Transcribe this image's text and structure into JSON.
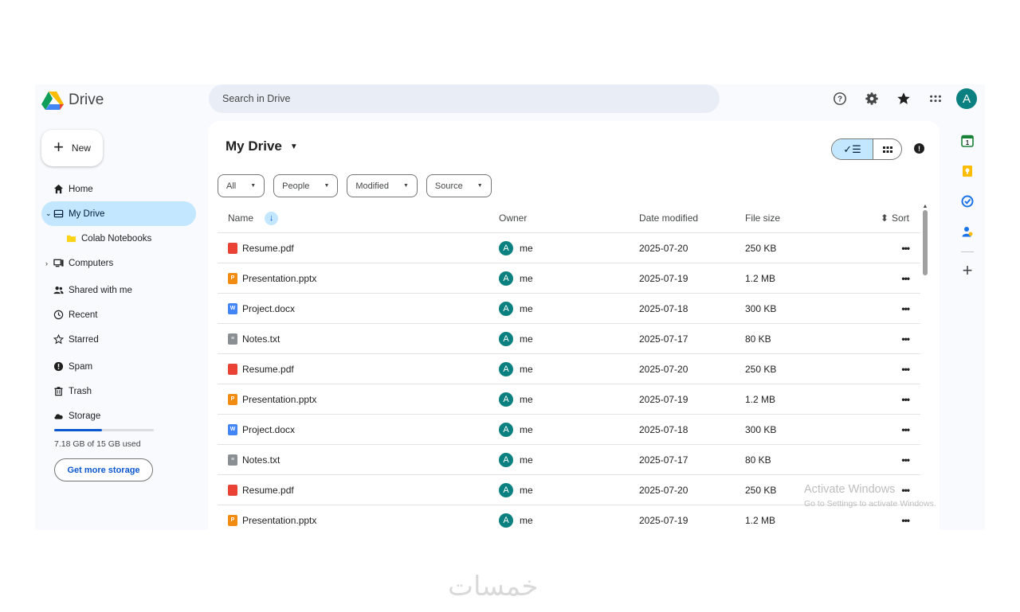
{
  "app": {
    "name": "Drive"
  },
  "search": {
    "placeholder": "Search in Drive"
  },
  "sidebar": {
    "new_label": "New",
    "items": [
      {
        "label": "Home"
      },
      {
        "label": "My Drive"
      },
      {
        "label": "Colab Notebooks"
      },
      {
        "label": "Computers"
      },
      {
        "label": "Shared with me"
      },
      {
        "label": "Recent"
      },
      {
        "label": "Starred"
      },
      {
        "label": "Spam"
      },
      {
        "label": "Trash"
      },
      {
        "label": "Storage"
      }
    ],
    "storage_used_fraction": 0.48,
    "storage_text": "7.18 GB of 15 GB used",
    "get_more_storage": "Get more storage"
  },
  "user": {
    "initial": "A"
  },
  "main": {
    "title": "My Drive",
    "filters": [
      "All",
      "People",
      "Modified",
      "Source"
    ],
    "columns": {
      "name": "Name",
      "owner": "Owner",
      "date": "Date modified",
      "size": "File size",
      "sort": "Sort"
    },
    "rows": [
      {
        "name": "Resume.pdf",
        "type": "pdf",
        "owner": "me",
        "date": "2025-07-20",
        "size": "250 KB"
      },
      {
        "name": "Presentation.pptx",
        "type": "pptx",
        "owner": "me",
        "date": "2025-07-19",
        "size": "1.2 MB"
      },
      {
        "name": "Project.docx",
        "type": "docx",
        "owner": "me",
        "date": "2025-07-18",
        "size": "300 KB"
      },
      {
        "name": "Notes.txt",
        "type": "txt",
        "owner": "me",
        "date": "2025-07-17",
        "size": "80 KB"
      },
      {
        "name": "Resume.pdf",
        "type": "pdf",
        "owner": "me",
        "date": "2025-07-20",
        "size": "250 KB"
      },
      {
        "name": "Presentation.pptx",
        "type": "pptx",
        "owner": "me",
        "date": "2025-07-19",
        "size": "1.2 MB"
      },
      {
        "name": "Project.docx",
        "type": "docx",
        "owner": "me",
        "date": "2025-07-18",
        "size": "300 KB"
      },
      {
        "name": "Notes.txt",
        "type": "txt",
        "owner": "me",
        "date": "2025-07-17",
        "size": "80 KB"
      },
      {
        "name": "Resume.pdf",
        "type": "pdf",
        "owner": "me",
        "date": "2025-07-20",
        "size": "250 KB"
      },
      {
        "name": "Presentation.pptx",
        "type": "pptx",
        "owner": "me",
        "date": "2025-07-19",
        "size": "1.2 MB"
      }
    ]
  },
  "overlay": {
    "activate_title": "Activate Windows",
    "activate_sub": "Go to Settings to activate Windows.",
    "watermark": "خمسات"
  },
  "colors": {
    "accent": "#0b57d0",
    "selected": "#c2e7ff",
    "avatar": "#0b8080"
  }
}
